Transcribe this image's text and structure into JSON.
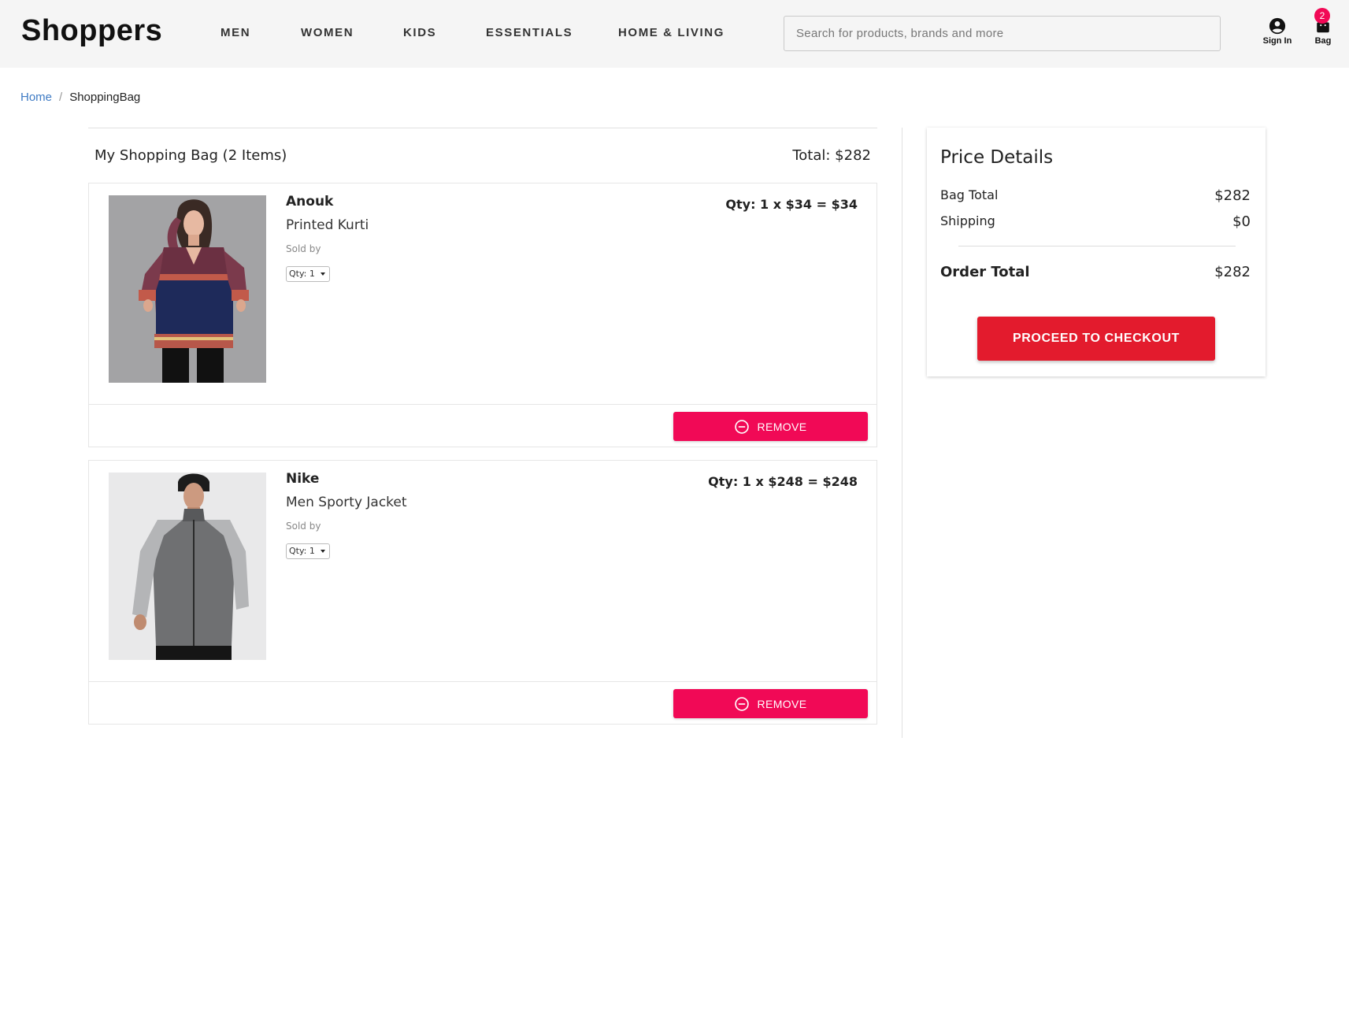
{
  "brand": "Shoppers",
  "nav": [
    "MEN",
    "WOMEN",
    "KIDS",
    "ESSENTIALS",
    "HOME & LIVING"
  ],
  "search": {
    "placeholder": "Search for products, brands and more"
  },
  "header_icons": {
    "signin_label": "Sign In",
    "bag_label": "Bag",
    "bag_count": "2",
    "signin_icon": "account-circle-icon",
    "bag_icon": "shopping-bag-icon"
  },
  "breadcrumb": {
    "home": "Home",
    "separator": "/",
    "current": "ShoppingBag"
  },
  "bag": {
    "title": "My Shopping Bag (2 Items)",
    "total": "Total: $282",
    "items": [
      {
        "brand": "Anouk",
        "name": "Printed Kurti",
        "sold_by": "Sold by",
        "qty_select": "Qty: 1",
        "price_line": "Qty: 1 x $34 = $34",
        "remove_label": "REMOVE",
        "image_icon": "product-image-kurti"
      },
      {
        "brand": "Nike",
        "name": "Men Sporty Jacket",
        "sold_by": "Sold by",
        "qty_select": "Qty: 1",
        "price_line": "Qty: 1 x $248 = $248",
        "remove_label": "REMOVE",
        "image_icon": "product-image-jacket"
      }
    ]
  },
  "price_details": {
    "title": "Price Details",
    "bag_total_label": "Bag Total",
    "bag_total_value": "$282",
    "shipping_label": "Shipping",
    "shipping_value": "$0",
    "order_total_label": "Order Total",
    "order_total_value": "$282",
    "checkout_label": "PROCEED TO CHECKOUT"
  },
  "colors": {
    "accent_pink": "#f10956",
    "checkout_red": "#e31b2d",
    "link_blue": "#3f7bc4",
    "header_bg": "#f5f5f5"
  }
}
